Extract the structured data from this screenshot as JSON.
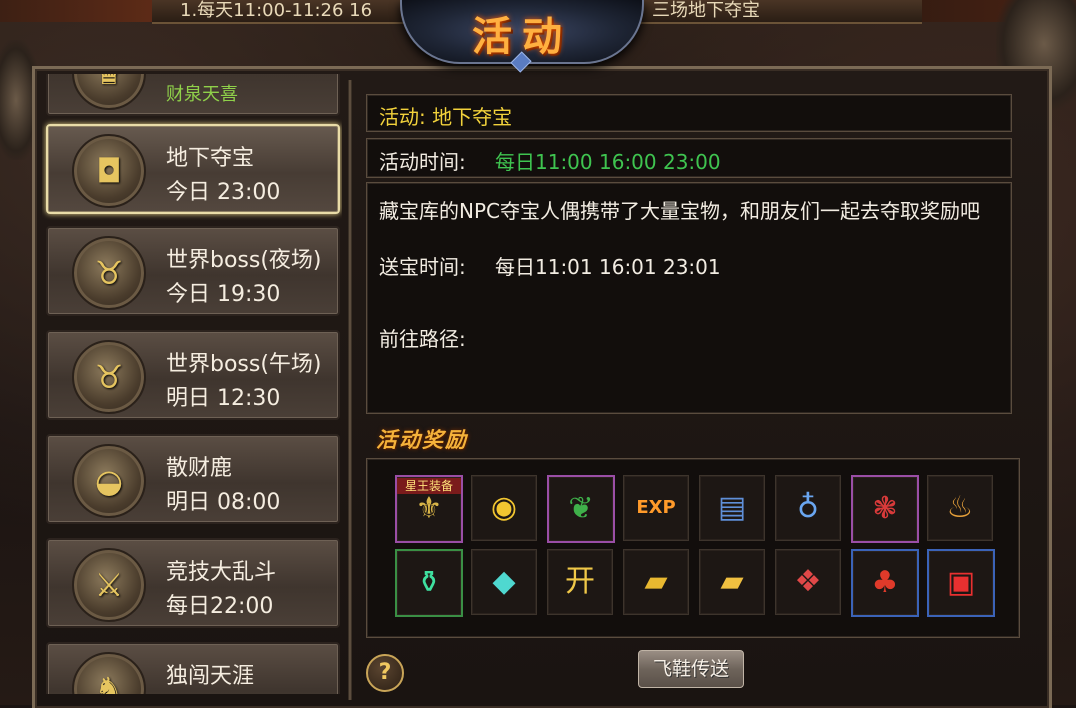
{
  "ticker": {
    "left": "1.每天11:00-11:26 16",
    "right": "三场地下夺宝"
  },
  "title": "活动",
  "list": [
    {
      "name": "财泉天喜",
      "time": "",
      "icon": "gold-statue-icon",
      "glyph": "♛"
    },
    {
      "name": "地下夺宝",
      "time": "今日 23:00",
      "icon": "treasure-chest-icon",
      "glyph": "◘",
      "selected": true
    },
    {
      "name": "世界boss(夜场)",
      "time": "今日 19:30",
      "icon": "bull-demon-icon",
      "glyph": "♉"
    },
    {
      "name": "世界boss(午场)",
      "time": "明日 12:30",
      "icon": "bull-demon-icon",
      "glyph": "♉"
    },
    {
      "name": "散财鹿",
      "time": "明日 08:00",
      "icon": "gold-ingot-icon",
      "glyph": "◒"
    },
    {
      "name": "竞技大乱斗",
      "time": "每日22:00",
      "icon": "crossed-swords-icon",
      "glyph": "⚔"
    },
    {
      "name": "独闯天涯",
      "time": "",
      "icon": "warrior-icon",
      "glyph": "♞"
    }
  ],
  "detail": {
    "activity_label": "活动:",
    "activity_name": "地下夺宝",
    "time_label": "活动时间:",
    "time_value": "每日11:00 16:00 23:00",
    "description": "藏宝库的NPC夺宝人偶携带了大量宝物，和朋友们一起去夺取奖励吧",
    "send_label": "送宝时间:",
    "send_value": "每日11:01 16:01 23:01",
    "route_label": "前往路径:"
  },
  "reward_title": "活动奖励",
  "rewards": [
    {
      "icon": "star-king-equipment-icon",
      "glyph": "⚜",
      "tag": "星王装备",
      "rarity": "purple",
      "color": "#d9b548"
    },
    {
      "icon": "gold-coins-icon",
      "glyph": "◉",
      "rarity": "none",
      "color": "#f2c630"
    },
    {
      "icon": "green-feather-icon",
      "glyph": "❦",
      "rarity": "purple",
      "color": "#3fb04a"
    },
    {
      "icon": "multi-exp-icon",
      "glyph": "EXP",
      "rarity": "none",
      "color": "#ff9a2a"
    },
    {
      "icon": "blue-book-icon",
      "glyph": "▤",
      "rarity": "none",
      "color": "#5f8fd8"
    },
    {
      "icon": "blue-potion-icon",
      "glyph": "♁",
      "rarity": "none",
      "color": "#6aa6f0"
    },
    {
      "icon": "red-crystal-icon",
      "glyph": "❃",
      "rarity": "purple",
      "color": "#d83a3a"
    },
    {
      "icon": "gourd-bag-icon",
      "glyph": "♨",
      "rarity": "none",
      "color": "#e6a03a"
    },
    {
      "icon": "green-potion-jar-icon",
      "glyph": "⚱",
      "rarity": "green",
      "color": "#3fe0a0"
    },
    {
      "icon": "cyan-crystal-icon",
      "glyph": "◆",
      "rarity": "none",
      "color": "#4fd8d0"
    },
    {
      "icon": "red-envelope-icon",
      "glyph": "开",
      "rarity": "none",
      "color": "#f0c848"
    },
    {
      "icon": "gold-bar-icon",
      "glyph": "▰",
      "rarity": "none",
      "color": "#e8b830"
    },
    {
      "icon": "gold-bars-stack-icon",
      "glyph": "▰",
      "rarity": "none",
      "color": "#f0c040"
    },
    {
      "icon": "gift-box-white-icon",
      "glyph": "❖",
      "rarity": "none",
      "color": "#e04848"
    },
    {
      "icon": "red-lucky-bag-icon",
      "glyph": "♣",
      "rarity": "blue",
      "color": "#e03a2a"
    },
    {
      "icon": "red-gift-box-icon",
      "glyph": "▣",
      "rarity": "blue",
      "color": "#e83030"
    }
  ],
  "help_label": "?",
  "fly_button": "飞鞋传送"
}
